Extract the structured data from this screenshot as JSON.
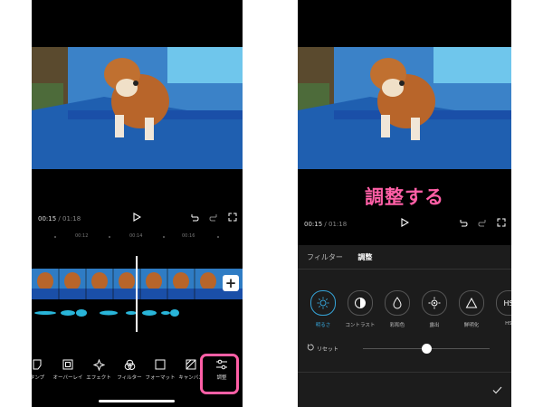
{
  "left": {
    "time_current": "00:15",
    "time_separator": "/",
    "time_total": "01:18",
    "ruler_labels": [
      "00:12",
      "00:14",
      "00:16"
    ],
    "toolbar": [
      {
        "label": "タンプ",
        "icon": "sticker-icon"
      },
      {
        "label": "オーバーレイ",
        "icon": "overlay-icon"
      },
      {
        "label": "エフェクト",
        "icon": "effect-icon"
      },
      {
        "label": "フィルター",
        "icon": "filter-icon"
      },
      {
        "label": "フォーマット",
        "icon": "format-icon"
      },
      {
        "label": "キャンバス",
        "icon": "canvas-icon"
      },
      {
        "label": "調整",
        "icon": "adjust-icon"
      }
    ],
    "highlight_color": "#ff5fa6"
  },
  "right": {
    "caption": "調整する",
    "time_current": "00:15",
    "time_separator": "/",
    "time_total": "01:18",
    "tabs": [
      {
        "label": "フィルター",
        "active": false
      },
      {
        "label": "調整",
        "active": true
      }
    ],
    "adjustments": [
      {
        "label": "明るさ",
        "icon": "brightness-icon",
        "active": true
      },
      {
        "label": "コントラスト",
        "icon": "contrast-icon",
        "active": false
      },
      {
        "label": "彩和色",
        "icon": "saturation-icon",
        "active": false
      },
      {
        "label": "露出",
        "icon": "exposure-icon",
        "active": false
      },
      {
        "label": "鮮明化",
        "icon": "sharpen-icon",
        "active": false
      },
      {
        "label": "HS",
        "icon": "hsl-icon",
        "active": false
      }
    ],
    "reset_label": "リセット",
    "slider_value": 0.5,
    "accent_color": "#36a4d8"
  }
}
